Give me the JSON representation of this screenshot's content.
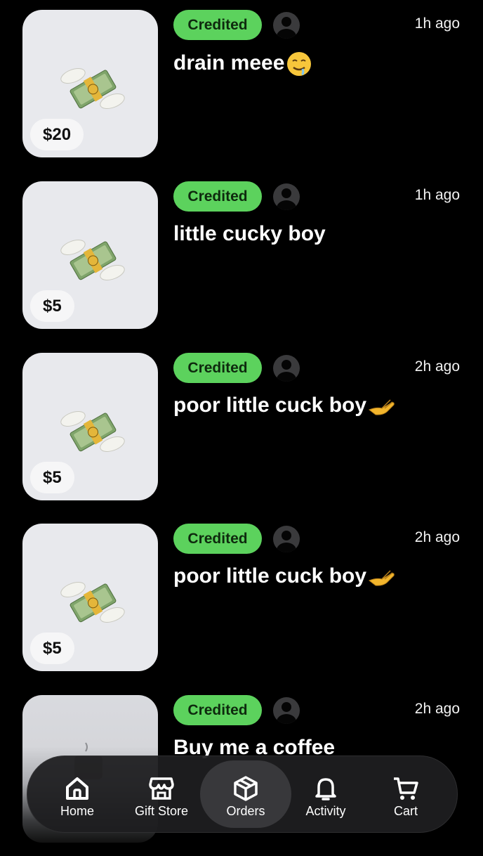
{
  "orders": [
    {
      "status": "Credited",
      "time": "1h ago",
      "message": "drain meee",
      "emoji": "drooling-face",
      "amount": "$20",
      "image": "money-with-wings"
    },
    {
      "status": "Credited",
      "time": "1h ago",
      "message": "little cucky boy",
      "emoji": "",
      "amount": "$5",
      "image": "money-with-wings"
    },
    {
      "status": "Credited",
      "time": "2h ago",
      "message": "poor little cuck boy",
      "emoji": "palm-up-hand",
      "amount": "$5",
      "image": "money-with-wings"
    },
    {
      "status": "Credited",
      "time": "2h ago",
      "message": "poor little cuck boy",
      "emoji": "palm-up-hand",
      "amount": "$5",
      "image": "money-with-wings"
    },
    {
      "status": "Credited",
      "time": "2h ago",
      "message": "Buy me a coffee",
      "emoji": "",
      "amount": "",
      "image": "coffee"
    }
  ],
  "nav": {
    "items": [
      {
        "label": "Home",
        "icon": "home-icon"
      },
      {
        "label": "Gift Store",
        "icon": "store-icon"
      },
      {
        "label": "Orders",
        "icon": "box-icon",
        "active": true
      },
      {
        "label": "Activity",
        "icon": "bell-icon"
      },
      {
        "label": "Cart",
        "icon": "cart-icon"
      }
    ]
  },
  "colors": {
    "badge": "#5cd25d",
    "background": "#000000",
    "thumb": "#e8e9ed"
  }
}
